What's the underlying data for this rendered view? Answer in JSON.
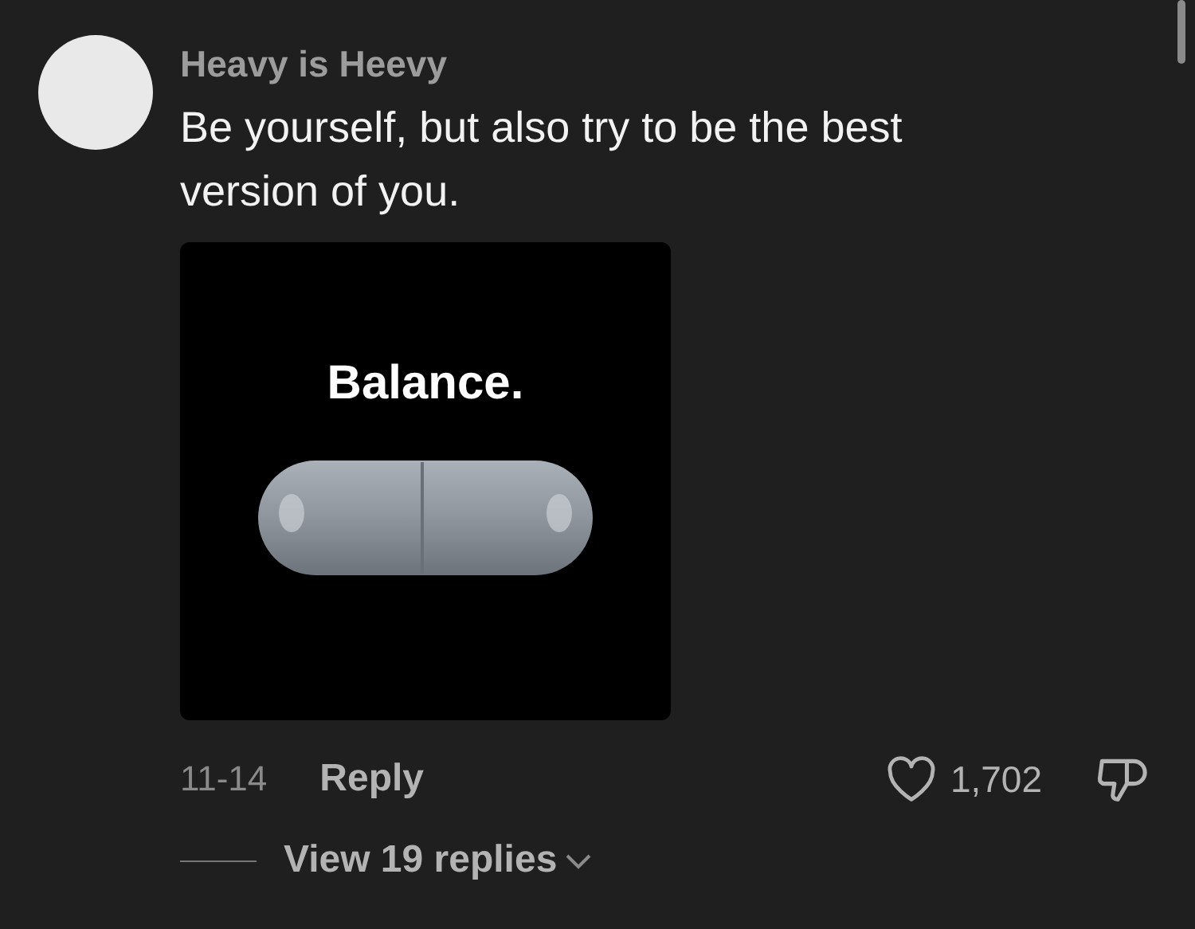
{
  "comment": {
    "author": "Heavy is Heevy",
    "text": "Be yourself, but also try to be the best version of you.",
    "attachment": {
      "caption": "Balance."
    },
    "date": "11-14",
    "reply_label": "Reply",
    "likes": "1,702",
    "liked": false,
    "disliked": false,
    "view_replies": "View 19 replies"
  }
}
